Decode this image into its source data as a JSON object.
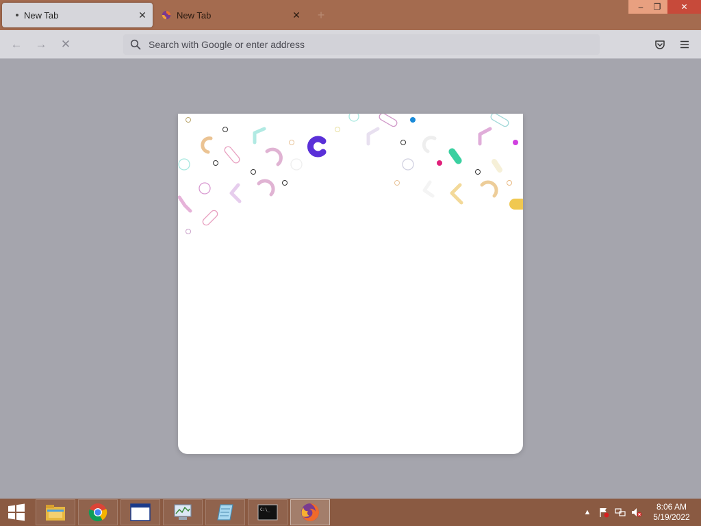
{
  "browser": {
    "tabs": [
      {
        "label": "New Tab",
        "state": "active",
        "loading": true
      },
      {
        "label": "New Tab",
        "state": "inactive"
      }
    ],
    "new_tab_glyph": "+",
    "window_controls": {
      "minimize": "–",
      "restore": "❐",
      "close": "✕"
    },
    "nav": {
      "back_glyph": "←",
      "forward_glyph": "→",
      "stop_glyph": "✕"
    },
    "urlbar": {
      "placeholder": "Search with Google or enter address",
      "value": ""
    },
    "toolbar_icons": [
      "pocket-icon",
      "menu-icon"
    ]
  },
  "colors": {
    "titlebar": "#a46b4f",
    "content_bg": "#a5a5ad",
    "taskbar": "#8a5a42",
    "window_close": "#c74a3a"
  },
  "taskbar": {
    "apps": [
      "file-explorer-icon",
      "chrome-icon",
      "window-app-icon",
      "task-manager-icon",
      "notepad-icon",
      "command-prompt-icon",
      "firefox-icon"
    ],
    "active_app": "firefox-icon",
    "tray_icons": [
      "show-hidden-icons-icon",
      "action-center-flag-icon",
      "network-icon",
      "volume-muted-icon"
    ],
    "clock": {
      "time": "8:06 AM",
      "date": "5/19/2022"
    }
  }
}
